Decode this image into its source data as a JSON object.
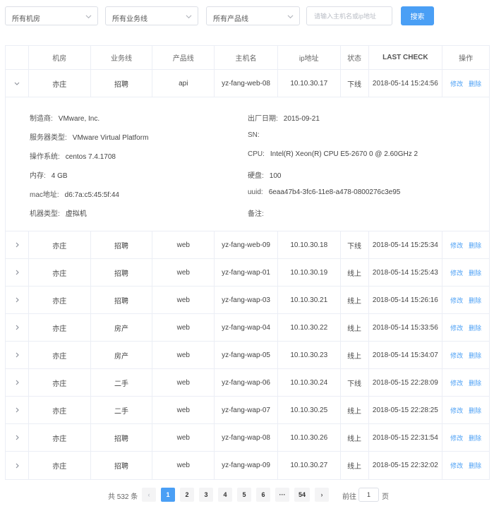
{
  "filters": {
    "room": "所有机房",
    "business": "所有业务线",
    "product": "所有产品线",
    "search_placeholder": "请输入主机名或ip地址",
    "search_button": "搜索"
  },
  "columns": [
    "机房",
    "业务线",
    "产品线",
    "主机名",
    "ip地址",
    "状态",
    "LAST CHECK",
    "操作"
  ],
  "actions": {
    "edit": "修改",
    "delete": "删除"
  },
  "rows": [
    {
      "room": "亦庄",
      "business": "招聘",
      "product": "api",
      "host": "yz-fang-web-08",
      "ip": "10.10.30.17",
      "status": "下线",
      "check": "2018-05-14 15:24:56",
      "expanded": true
    },
    {
      "room": "亦庄",
      "business": "招聘",
      "product": "web",
      "host": "yz-fang-web-09",
      "ip": "10.10.30.18",
      "status": "下线",
      "check": "2018-05-14 15:25:34"
    },
    {
      "room": "亦庄",
      "business": "招聘",
      "product": "web",
      "host": "yz-fang-wap-01",
      "ip": "10.10.30.19",
      "status": "线上",
      "check": "2018-05-14 15:25:43"
    },
    {
      "room": "亦庄",
      "business": "招聘",
      "product": "web",
      "host": "yz-fang-wap-03",
      "ip": "10.10.30.21",
      "status": "线上",
      "check": "2018-05-14 15:26:16"
    },
    {
      "room": "亦庄",
      "business": "房产",
      "product": "web",
      "host": "yz-fang-wap-04",
      "ip": "10.10.30.22",
      "status": "线上",
      "check": "2018-05-14 15:33:56"
    },
    {
      "room": "亦庄",
      "business": "房产",
      "product": "web",
      "host": "yz-fang-wap-05",
      "ip": "10.10.30.23",
      "status": "线上",
      "check": "2018-05-14 15:34:07"
    },
    {
      "room": "亦庄",
      "business": "二手",
      "product": "web",
      "host": "yz-fang-wap-06",
      "ip": "10.10.30.24",
      "status": "下线",
      "check": "2018-05-15 22:28:09"
    },
    {
      "room": "亦庄",
      "business": "二手",
      "product": "web",
      "host": "yz-fang-wap-07",
      "ip": "10.10.30.25",
      "status": "线上",
      "check": "2018-05-15 22:28:25"
    },
    {
      "room": "亦庄",
      "business": "招聘",
      "product": "web",
      "host": "yz-fang-wap-08",
      "ip": "10.10.30.26",
      "status": "线上",
      "check": "2018-05-15 22:31:54"
    },
    {
      "room": "亦庄",
      "business": "招聘",
      "product": "web",
      "host": "yz-fang-wap-09",
      "ip": "10.10.30.27",
      "status": "线上",
      "check": "2018-05-15 22:32:02"
    }
  ],
  "detail": {
    "left": [
      {
        "k": "制造商:",
        "v": "VMware, Inc."
      },
      {
        "k": "服务器类型:",
        "v": "VMware Virtual Platform"
      },
      {
        "k": "操作系统:",
        "v": "centos 7.4.1708"
      },
      {
        "k": "内存:",
        "v": "4 GB"
      },
      {
        "k": "mac地址:",
        "v": "d6:7a:c5:45:5f:44"
      },
      {
        "k": "机器类型:",
        "v": "虚拟机"
      }
    ],
    "right": [
      {
        "k": "出厂日期:",
        "v": "2015-09-21"
      },
      {
        "k": "SN:",
        "v": ""
      },
      {
        "k": "CPU:",
        "v": "Intel(R) Xeon(R) CPU E5-2670 0 @ 2.60GHz 2"
      },
      {
        "k": "硬盘:",
        "v": "100"
      },
      {
        "k": "uuid:",
        "v": "6eaa47b4-3fc6-11e8-a478-0800276c3e95"
      },
      {
        "k": "备注:",
        "v": ""
      }
    ]
  },
  "pagination": {
    "total": "共 532 条",
    "prev": "‹",
    "next": "›",
    "pages": [
      "1",
      "2",
      "3",
      "4",
      "5",
      "6",
      "···",
      "54"
    ],
    "active_page": "1",
    "goto_prefix": "前往",
    "goto_value": "1",
    "goto_suffix": "页"
  },
  "colors": {
    "accent": "#4a9ff5",
    "border": "#ebeef5"
  },
  "icons": {
    "dropdown": "chevron-down-icon",
    "collapsed_row": "chevron-right-icon",
    "expanded_row": "chevron-down-icon"
  }
}
